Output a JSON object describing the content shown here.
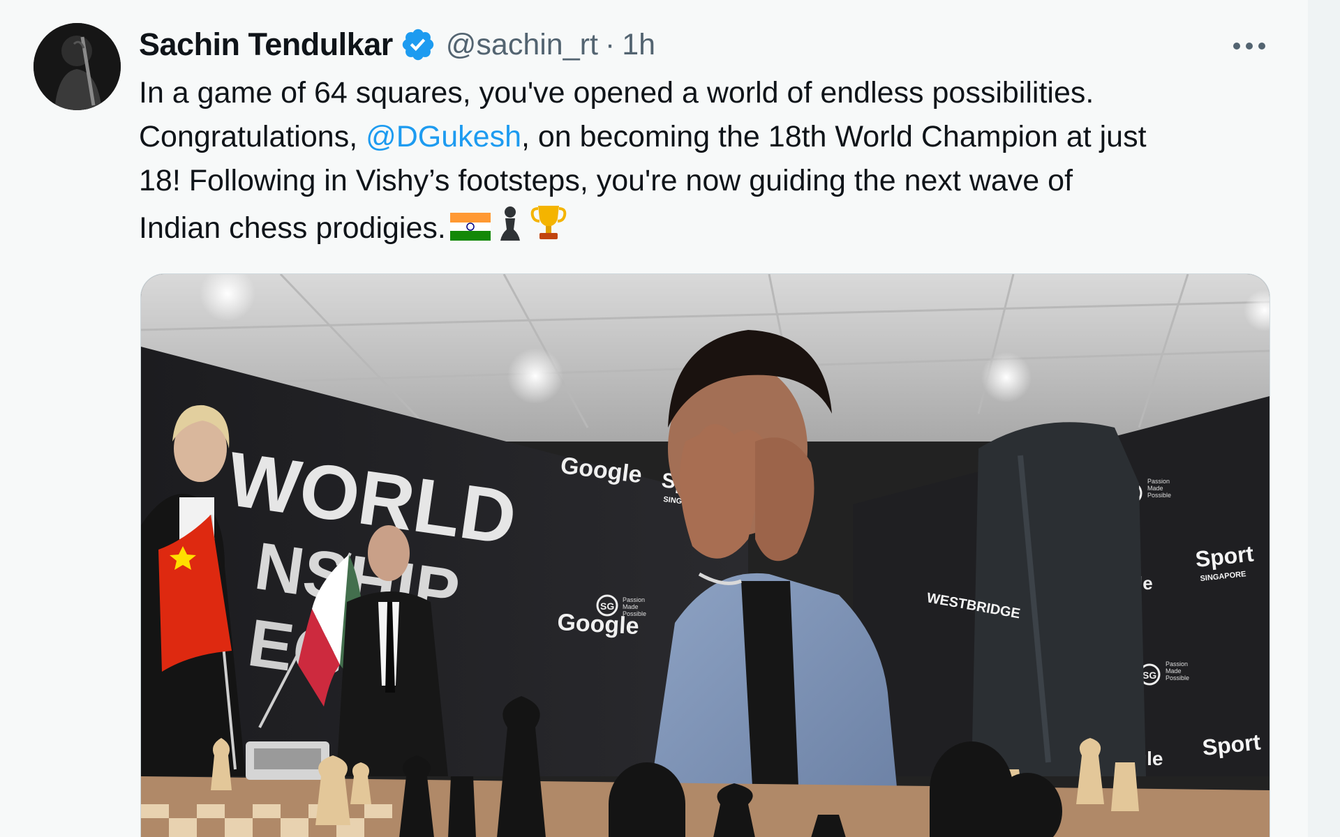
{
  "author": {
    "display_name": "Sachin Tendulkar",
    "handle": "@sachin_rt",
    "separator": "·",
    "timestamp": "1h",
    "verified": true,
    "verified_color": "#1d9bf0"
  },
  "tweet": {
    "line1": "In a game of 64 squares, you've opened a world of endless possibilities.",
    "line2_prefix": "Congratulations, ",
    "mention": "@DGukesh",
    "line2_suffix": ", on becoming the 18th World Champion at just",
    "line3": "18! Following in Vishy’s footsteps, you're now guiding the next wave of",
    "line4": "Indian chess prodigies.",
    "emojis": [
      "india-flag-icon",
      "chess-pawn-icon",
      "trophy-icon"
    ]
  },
  "media": {
    "backdrop_text_1": "WORLD",
    "backdrop_text_2": "NSHIP",
    "backdrop_text_3": "EG",
    "sponsor_google": "Google",
    "sponsor_sport": "Sport",
    "sponsor_sport_sub": "SINGAPORE",
    "sponsor_sg": "SG",
    "sponsor_sg_sub1": "Passion",
    "sponsor_sg_sub2": "Made",
    "sponsor_sg_sub3": "Possible",
    "sleeve_text": "WESTBRIDGE",
    "right_cut_1": "le",
    "right_cut_2": "gle"
  },
  "colors": {
    "text": "#0f1419",
    "secondary": "#536471",
    "link": "#1d9bf0",
    "background": "#f7f9f9"
  },
  "icons": {
    "verified": "verified-badge-icon",
    "more": "more-options-icon"
  }
}
